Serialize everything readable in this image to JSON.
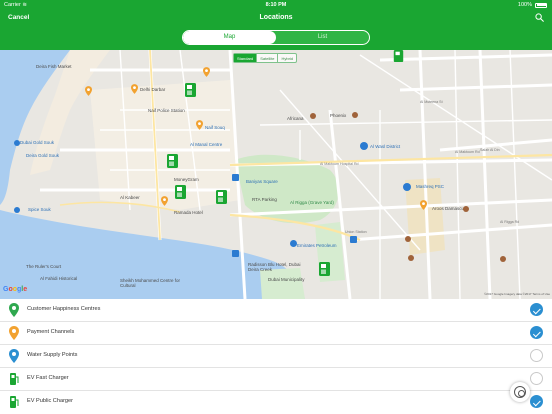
{
  "status_bar": {
    "carrier": "Carrier ≋",
    "time": "8:10 PM",
    "battery": "100%"
  },
  "nav": {
    "cancel_label": "Cancel",
    "title": "Locations"
  },
  "tabs": {
    "map_label": "Map",
    "list_label": "List",
    "selected": "Map"
  },
  "map": {
    "type_options": [
      "Standard",
      "Satellite",
      "Hybrid"
    ],
    "selected_type": "Standard",
    "attribution": "©2017 Google  Imagery data ©2017  Terms of Use",
    "labels": [
      "Deira Fish Market",
      "Delhi Darbar",
      "Naif Police Station",
      "Naif Souq",
      "Al Manal Centre",
      "Dubai Gold Souk",
      "Deira Gold Souk",
      "MoneyGram",
      "Al Kabeer",
      "Ramada Hotel",
      "Baniyas Square",
      "RTA Parking",
      "Al Rigga (Grave Yard)",
      "Africana",
      "Phoenix",
      "Al Wasl District",
      "Mashreq PSC",
      "Aroos Damascus",
      "Emirates Petroleum",
      "Union Station",
      "Radisson Blu Hotel, Dubai Deira Creek",
      "Dubai Municipality",
      "Spice Souk",
      "The Ruler's Court",
      "Al Fahidi Historical",
      "Sheikh Mohammed Centre for Cultural",
      "Al Maktoum Hospital Rd",
      "Al Maktoum Rd",
      "Al Muteena St",
      "Salah Al Din",
      "Al Rigga Rd"
    ]
  },
  "legend": [
    {
      "label": "Customer Happiness Centres",
      "icon": "green-pin-icon",
      "color": "#2fa84f",
      "checked": true
    },
    {
      "label": "Payment Channels",
      "icon": "orange-pin-icon",
      "color": "#f2a230",
      "checked": true
    },
    {
      "label": "Water Supply Points",
      "icon": "blue-pin-icon",
      "color": "#2b8fd1",
      "checked": false
    },
    {
      "label": "EV Fast Charger",
      "icon": "ev-fast-charger-icon",
      "color": "#1aa632",
      "checked": false
    },
    {
      "label": "EV Public Charger",
      "icon": "ev-public-charger-icon",
      "color": "#1aa632",
      "checked": true
    }
  ],
  "colors": {
    "brand_green": "#1aa632",
    "check_blue": "#2b8fd1",
    "water": "#aacdf0"
  }
}
